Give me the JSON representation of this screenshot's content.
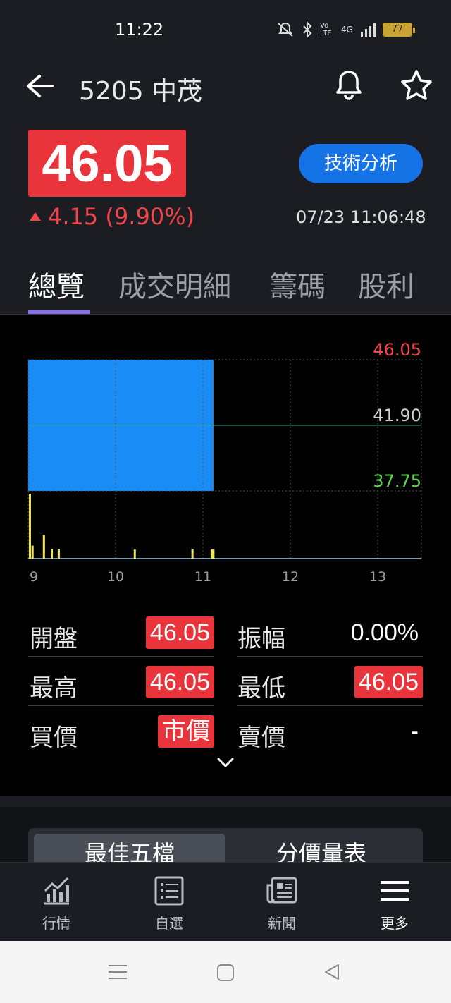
{
  "status": {
    "time": "11:22",
    "volte": "Vo LTE",
    "network": "4G",
    "battery": "77"
  },
  "header": {
    "title": "5205 中茂",
    "price": "46.05",
    "change": "4.15 (9.90%)",
    "datetime": "07/23 11:06:48",
    "tech_button": "技術分析",
    "colors": {
      "up": "#f4454a",
      "price_bg": "#e8343a",
      "button": "#1673e6",
      "tab_accent": "#8a6cf0"
    }
  },
  "tabs": [
    {
      "label": "總覽",
      "active": true
    },
    {
      "label": "成交明細",
      "active": false
    },
    {
      "label": "籌碼",
      "active": false
    },
    {
      "label": "股利",
      "active": false
    }
  ],
  "chart_data": {
    "type": "area",
    "title": "",
    "xlabel": "",
    "ylabel": "",
    "x_ticks": [
      "9",
      "10",
      "11",
      "12",
      "13"
    ],
    "y_ticks": [
      "46.05",
      "41.90",
      "37.75"
    ],
    "ylim": [
      37.75,
      46.05
    ],
    "reference_price": 41.9,
    "price_series": {
      "name": "",
      "x": [
        9.0,
        11.12
      ],
      "y": [
        46.05,
        46.05
      ]
    },
    "volume_series": {
      "name": "",
      "x": [
        9.02,
        9.05,
        9.18,
        9.27,
        9.35,
        10.22,
        10.88,
        11.1,
        11.12
      ],
      "relative": [
        1.0,
        0.2,
        0.37,
        0.15,
        0.15,
        0.14,
        0.15,
        0.14,
        0.14
      ]
    },
    "grid": true,
    "colors": {
      "price_fill": "#1a8cf5",
      "volume": "#f0e85a",
      "up_label": "#f4454a",
      "ref_label": "#d0d0d0",
      "down_label": "#5ed64a"
    }
  },
  "stats": {
    "open_label": "開盤",
    "open_value": "46.05",
    "amplitude_label": "振幅",
    "amplitude_value": "0.00%",
    "high_label": "最高",
    "high_value": "46.05",
    "low_label": "最低",
    "low_value": "46.05",
    "bid_label": "買價",
    "bid_value": "市價",
    "ask_label": "賣價",
    "ask_value": "-"
  },
  "segment": {
    "option_a": "最佳五檔",
    "option_b": "分價量表"
  },
  "nav": [
    {
      "label": "行情",
      "icon": "chart-icon"
    },
    {
      "label": "自選",
      "icon": "list-icon"
    },
    {
      "label": "新聞",
      "icon": "news-icon"
    },
    {
      "label": "更多",
      "icon": "menu-icon",
      "active": true
    }
  ]
}
